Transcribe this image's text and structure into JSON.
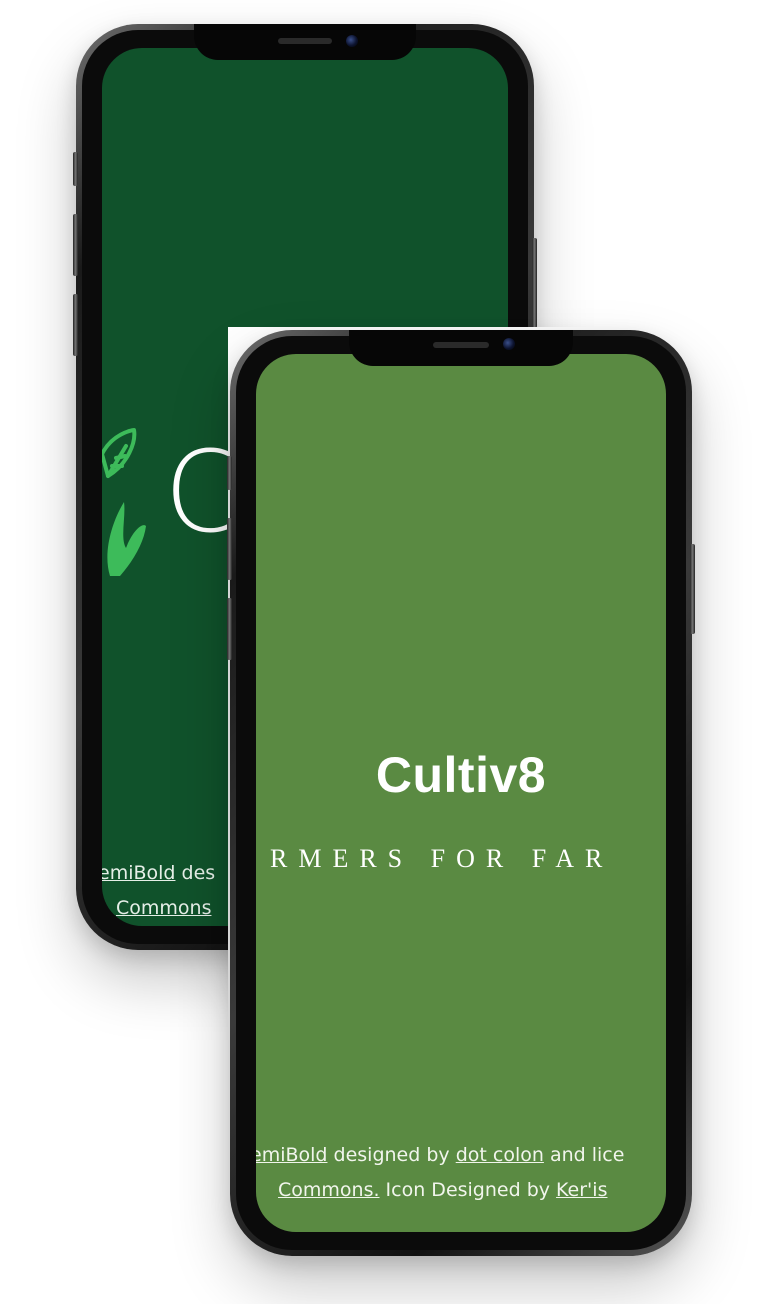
{
  "back_screen": {
    "background_color": "#10522b",
    "accent_color": "#3dbb5a",
    "logo_icon": "leaf-hand-icon",
    "partial_title": "C",
    "credits_line1": [
      {
        "text": "emiBold",
        "link": true
      },
      {
        "text": " des",
        "link": false
      }
    ],
    "credits_line2": [
      {
        "text": "Commons",
        "link": true
      }
    ]
  },
  "front_screen": {
    "background_color": "#5a8a42",
    "app_title": "Cultiv8",
    "tagline": "RMERS FOR FAR",
    "credits_line1": [
      {
        "text": "emiBold",
        "link": true
      },
      {
        "text": " designed by ",
        "link": false
      },
      {
        "text": "dot colon",
        "link": true
      },
      {
        "text": " and lice",
        "link": false
      }
    ],
    "credits_line2": [
      {
        "text": "Commons.",
        "link": true
      },
      {
        "text": " Icon Designed by ",
        "link": false
      },
      {
        "text": "Ker'is",
        "link": true
      }
    ]
  }
}
